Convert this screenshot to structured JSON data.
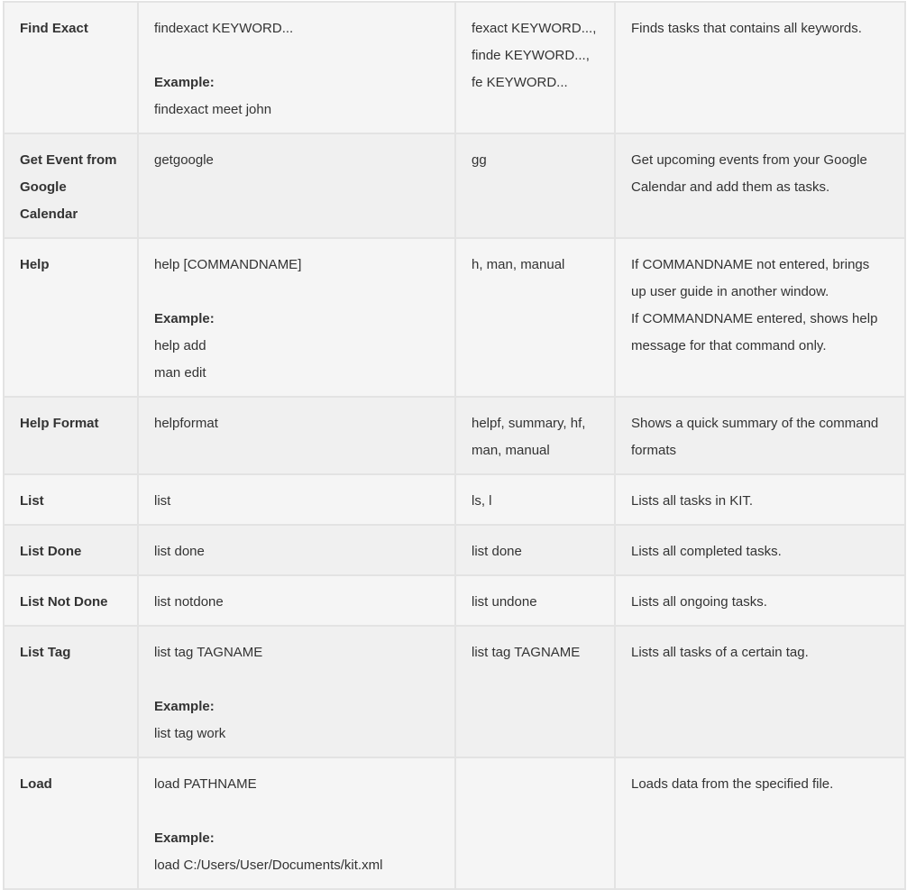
{
  "rows": [
    {
      "command": "Find Exact",
      "format": [
        "findexact KEYWORD..."
      ],
      "example_label": "Example:",
      "examples": [
        "findexact meet john"
      ],
      "shortcuts": [
        "fexact KEYWORD...,",
        "finde KEYWORD...,",
        "fe KEYWORD..."
      ],
      "description": [
        "Finds tasks that contains all keywords."
      ]
    },
    {
      "command": "Get Event from Google Calendar",
      "format": [
        "getgoogle"
      ],
      "examples": [],
      "shortcuts": [
        "gg"
      ],
      "description": [
        "Get upcoming events from your Google Calendar and add them as tasks."
      ]
    },
    {
      "command": "Help",
      "format": [
        "help [COMMANDNAME]"
      ],
      "example_label": "Example:",
      "examples": [
        "help add",
        "man edit"
      ],
      "shortcuts": [
        "h, man, manual"
      ],
      "description": [
        "If COMMANDNAME not entered, brings up user guide in another window.",
        "If COMMANDNAME entered, shows help message for that command only."
      ]
    },
    {
      "command": "Help Format",
      "format": [
        "helpformat"
      ],
      "examples": [],
      "shortcuts": [
        "helpf, summary, hf, man, manual"
      ],
      "description": [
        "Shows a quick summary of the command formats"
      ]
    },
    {
      "command": "List",
      "format": [
        "list"
      ],
      "examples": [],
      "shortcuts": [
        "ls, l"
      ],
      "description": [
        "Lists all tasks in KIT."
      ]
    },
    {
      "command": "List Done",
      "format": [
        "list done"
      ],
      "examples": [],
      "shortcuts": [
        "list done"
      ],
      "description": [
        "Lists all completed tasks."
      ]
    },
    {
      "command": "List Not Done",
      "format": [
        "list notdone"
      ],
      "examples": [],
      "shortcuts": [
        "list undone"
      ],
      "description": [
        "Lists all ongoing tasks."
      ]
    },
    {
      "command": "List Tag",
      "format": [
        "list tag TAGNAME"
      ],
      "example_label": "Example:",
      "examples": [
        "list tag work"
      ],
      "shortcuts": [
        "list tag TAGNAME"
      ],
      "description": [
        "Lists all tasks of a certain tag."
      ]
    },
    {
      "command": "Load",
      "format": [
        "load PATHNAME"
      ],
      "example_label": "Example:",
      "examples": [
        "load C:/Users/User/Documents/kit.xml"
      ],
      "shortcuts": [],
      "description": [
        "Loads data from the specified file."
      ]
    }
  ]
}
